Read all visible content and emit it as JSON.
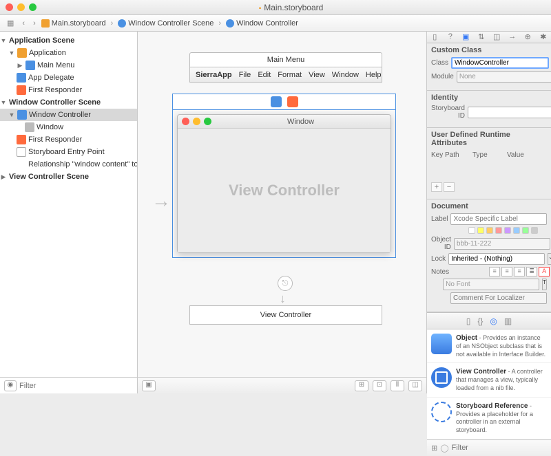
{
  "titlebar": {
    "filename": "Main.storyboard"
  },
  "breadcrumb": {
    "back": "‹",
    "fwd": "›",
    "items": [
      "Main.storyboard",
      "Window Controller Scene",
      "Window Controller"
    ]
  },
  "outline": {
    "scenes": [
      {
        "title": "Application Scene",
        "children": [
          {
            "label": "Application",
            "icon": "app",
            "children": [
              {
                "label": "Main Menu",
                "icon": "menu"
              }
            ]
          },
          {
            "label": "App Delegate",
            "icon": "delegate"
          },
          {
            "label": "First Responder",
            "icon": "responder"
          }
        ]
      },
      {
        "title": "Window Controller Scene",
        "children": [
          {
            "label": "Window Controller",
            "icon": "wc",
            "selected": true,
            "children": [
              {
                "label": "Window",
                "icon": "win"
              }
            ]
          },
          {
            "label": "First Responder",
            "icon": "responder"
          },
          {
            "label": "Storyboard Entry Point",
            "icon": "entry"
          },
          {
            "label": "Relationship \"window content\" to \"...",
            "icon": "rel"
          }
        ]
      },
      {
        "title": "View Controller Scene"
      }
    ],
    "filter_placeholder": "Filter"
  },
  "canvas": {
    "menu": {
      "title": "Main Menu",
      "items": [
        "SierraApp",
        "File",
        "Edit",
        "Format",
        "View",
        "Window",
        "Help"
      ]
    },
    "window": {
      "title": "Window",
      "content_label": "View Controller"
    },
    "vc_label": "View Controller"
  },
  "inspector": {
    "custom_class": {
      "heading": "Custom Class",
      "class_label": "Class",
      "class_value": "WindowController",
      "module_label": "Module",
      "module_value": "None"
    },
    "identity": {
      "heading": "Identity",
      "sid_label": "Storyboard ID",
      "sid_value": ""
    },
    "runtime": {
      "heading": "User Defined Runtime Attributes",
      "cols": [
        "Key Path",
        "Type",
        "Value"
      ]
    },
    "document": {
      "heading": "Document",
      "label_label": "Label",
      "label_placeholder": "Xcode Specific Label",
      "objid_label": "Object ID",
      "objid_value": "bbb-11-222",
      "lock_label": "Lock",
      "lock_value": "Inherited - (Nothing)",
      "notes_label": "Notes",
      "nofont": "No Font",
      "localizer": "Comment For Localizer"
    },
    "library": {
      "items": [
        {
          "title": "Object",
          "desc": " - Provides an instance of an NSObject subclass that is not available in Interface Builder."
        },
        {
          "title": "View Controller",
          "desc": " - A controller that manages a view, typically loaded from a nib file."
        },
        {
          "title": "Storyboard Reference",
          "desc": " - Provides a placeholder for a controller in an external storyboard."
        }
      ],
      "filter_placeholder": "Filter"
    }
  }
}
